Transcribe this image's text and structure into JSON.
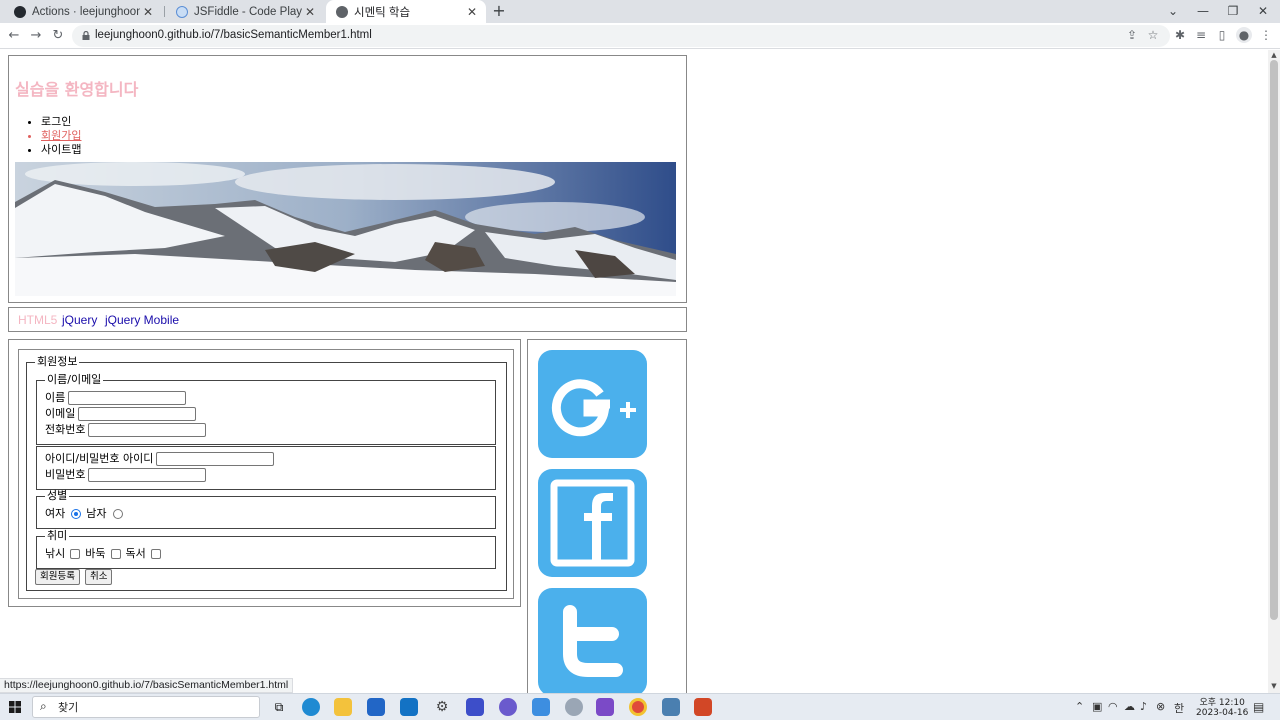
{
  "browser": {
    "tabs": [
      {
        "title": "Actions · leejunghoon0/lee",
        "active": false
      },
      {
        "title": "JSFiddle - Code Playground",
        "active": false
      },
      {
        "title": "시멘틱 학습",
        "active": true
      }
    ],
    "url": "leejunghoon0.github.io/7/basicSemanticMember1.html",
    "status_url": "https://leejunghoon0.github.io/7/basicSemanticMember1.html"
  },
  "page": {
    "title": "실습을 환영합니다",
    "nav": [
      "로그인",
      "회원가입",
      "사이트맵"
    ],
    "menu": [
      "HTML5",
      "jQuery",
      "jQuery Mobile"
    ],
    "form": {
      "legend_main": "회원정보",
      "legend_name": "이름/이메일",
      "name_label": "이름",
      "email_label": "이메일",
      "phone_label": "전화번호",
      "account_text": "아이디/비밀번호 아이디",
      "password_label": "비밀번호",
      "legend_gender": "성별",
      "female_label": "여자",
      "male_label": "남자",
      "legend_hobby": "취미",
      "hobby_fishing": "낚시",
      "hobby_baduk": "바둑",
      "hobby_reading": "독서",
      "submit_label": "회원등록",
      "cancel_label": "취소",
      "gender_selected": "여자"
    },
    "social": [
      "google-plus-icon",
      "facebook-icon",
      "twitter-icon"
    ]
  },
  "taskbar": {
    "search_label": "찾기",
    "ime": "한",
    "time": "오후 12:10",
    "date": "2023-04-16"
  },
  "colors": {
    "title_pink": "#f4b6c2",
    "link_red": "#e0605e",
    "link_blue": "#1a0dab",
    "social_blue": "#4bb0ec"
  }
}
